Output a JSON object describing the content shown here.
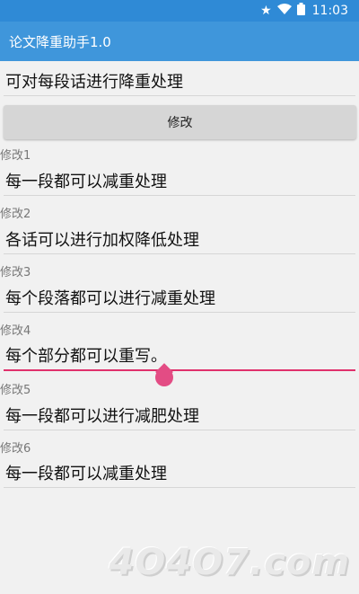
{
  "status_bar": {
    "time": "11:03"
  },
  "app_bar": {
    "title": "论文降重助手1.0"
  },
  "input": {
    "value": "可对每段话进行降重处理"
  },
  "submit_button": {
    "label": "修改"
  },
  "results": [
    {
      "label": "修改1",
      "text": "每一段都可以减重处理"
    },
    {
      "label": "修改2",
      "text": "各话可以进行加权降低处理"
    },
    {
      "label": "修改3",
      "text": "每个段落都可以进行减重处理"
    },
    {
      "label": "修改4",
      "text": "每个部分都可以重写。"
    },
    {
      "label": "修改5",
      "text": "每一段都可以进行减肥处理"
    },
    {
      "label": "修改6",
      "text": "每一段都可以减重处理"
    }
  ],
  "watermark": {
    "text": "4O4O7.com"
  },
  "colors": {
    "status_bar": "#2f8ad6",
    "app_bar": "#3f96db",
    "accent": "#e0316c"
  },
  "icons": [
    "star-icon",
    "wifi-icon",
    "battery-icon"
  ]
}
